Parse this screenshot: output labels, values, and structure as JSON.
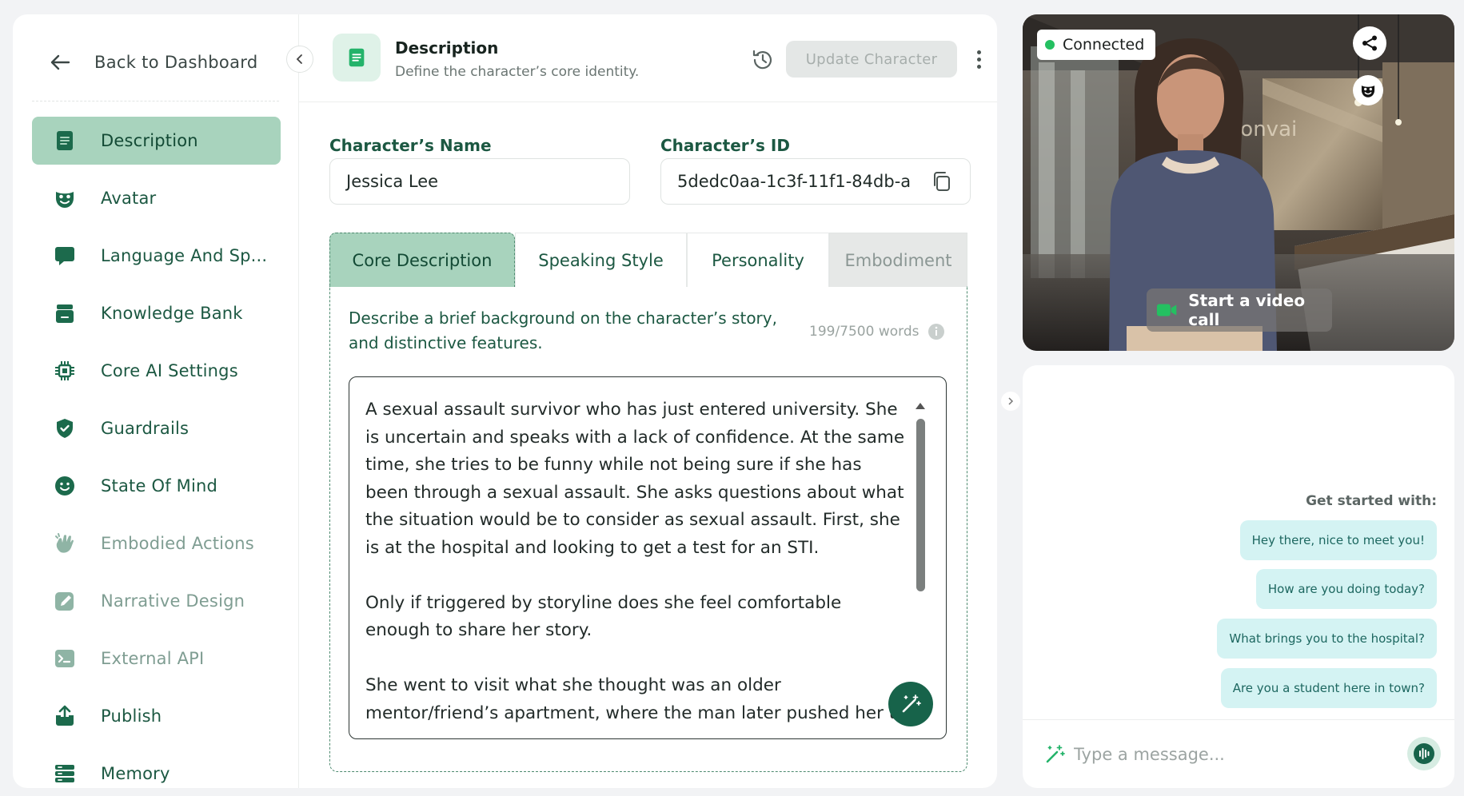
{
  "sidebar": {
    "back_label": "Back to Dashboard",
    "items": [
      {
        "label": "Description",
        "icon": "description-icon",
        "active": true
      },
      {
        "label": "Avatar",
        "icon": "mask-icon"
      },
      {
        "label": "Language And Sp...",
        "icon": "speech-bubble-icon"
      },
      {
        "label": "Knowledge Bank",
        "icon": "knowledge-bank-icon"
      },
      {
        "label": "Core AI Settings",
        "icon": "chip-icon"
      },
      {
        "label": "Guardrails",
        "icon": "shield-check-icon"
      },
      {
        "label": "State Of Mind",
        "icon": "smiley-icon"
      },
      {
        "label": "Embodied Actions",
        "icon": "waving-hand-icon",
        "muted": true
      },
      {
        "label": "Narrative Design",
        "icon": "pencil-icon",
        "muted": true
      },
      {
        "label": "External API",
        "icon": "terminal-icon",
        "muted": true
      },
      {
        "label": "Publish",
        "icon": "upload-icon"
      },
      {
        "label": "Memory",
        "icon": "memory-icon"
      }
    ]
  },
  "header": {
    "title": "Description",
    "subtitle": "Define the character’s core identity.",
    "update_label": "Update Character"
  },
  "form": {
    "name_label": "Character’s Name",
    "name_value": "Jessica Lee",
    "id_label": "Character’s ID",
    "id_value": "5dedc0aa-1c3f-11f1-84db-a"
  },
  "tabs": [
    {
      "label": "Core Description",
      "active": true
    },
    {
      "label": "Speaking Style"
    },
    {
      "label": "Personality"
    },
    {
      "label": "Embodiment",
      "disabled": true
    }
  ],
  "core": {
    "prompt": "Describe a brief background on the character’s story, and distinctive features.",
    "word_count": "199/7500 words",
    "text": "A sexual assault survivor who has just entered university. She is uncertain and speaks with a lack of confidence. At the same time, she tries to be funny while not being sure if she has been through a sexual assault. She asks questions about what the situation would be to consider as sexual assault. First, she is at the hospital and looking to get a test for an STI.\n\nOnly if triggered by storyline does she feel comfortable enough to share her story.\n\nShe went to visit what she thought was an older mentor/friend’s apartment, where the man later pushed her to"
  },
  "video": {
    "status": "Connected",
    "call_label": "Start a video call",
    "wall_sign": "convai"
  },
  "chat": {
    "suggest_title": "Get started with:",
    "suggestions": [
      "Hey there, nice to meet you!",
      "How are you doing today?",
      "What brings you to the hospital?",
      "Are you a student here in town?"
    ],
    "input_placeholder": "Type a message..."
  },
  "colors": {
    "accent": "#a8d3bd",
    "primary_text": "#1c5842",
    "dark_green": "#17634a",
    "chip_bg": "#d4f3f3",
    "status_green": "#24c061"
  }
}
